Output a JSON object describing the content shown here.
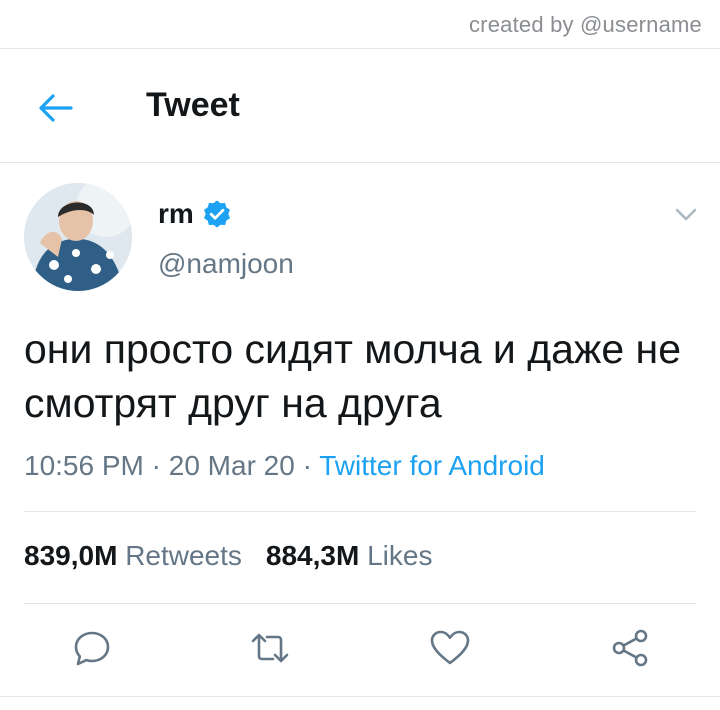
{
  "watermark": "created by @username",
  "header": {
    "title": "Tweet",
    "back_icon": "arrow-left-icon"
  },
  "tweet": {
    "display_name": "rm",
    "verified": true,
    "handle": "@namjoon",
    "text": "они просто сидят молча и даже не смотрят друг на друга",
    "time": "10:56 PM",
    "separator": "·",
    "date": "20 Mar 20",
    "source": "Twitter for Android",
    "retweets_count": "839,0M",
    "retweets_label": "Retweets",
    "likes_count": "884,3M",
    "likes_label": "Likes"
  },
  "actions": [
    "reply-icon",
    "retweet-icon",
    "like-icon",
    "share-icon"
  ],
  "colors": {
    "accent": "#1da1f2",
    "text": "#14171a",
    "secondary": "#657786",
    "divider": "#e1e8ed"
  }
}
